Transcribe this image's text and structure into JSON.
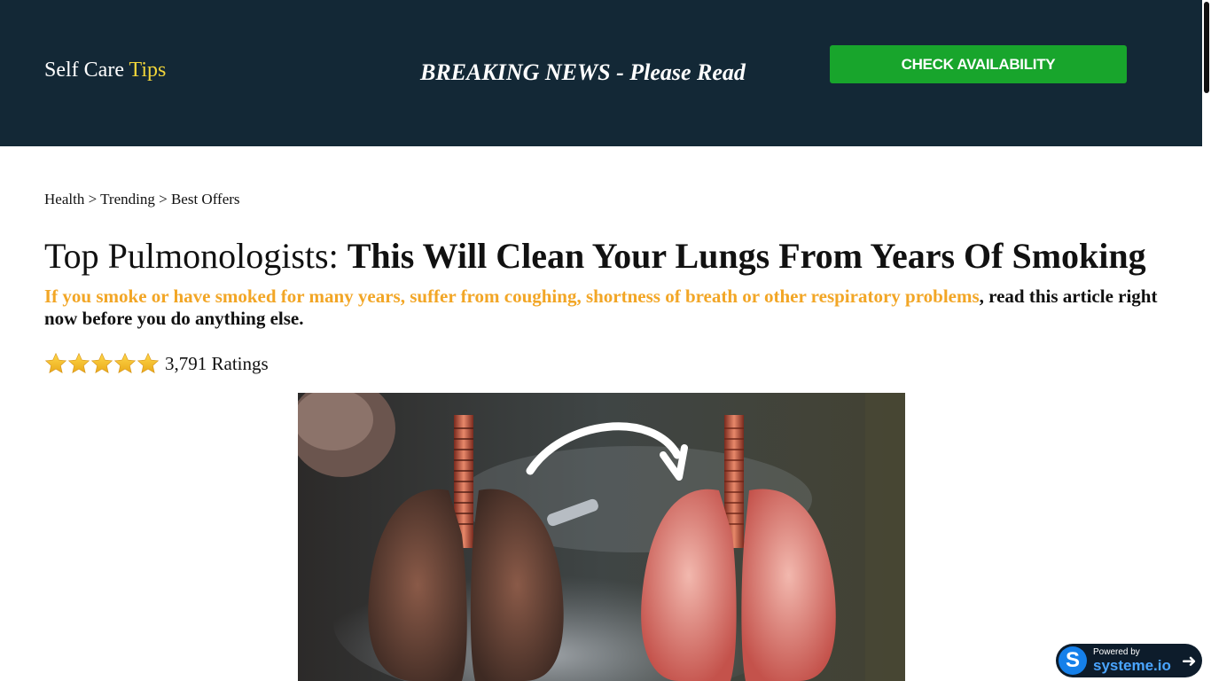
{
  "header": {
    "brand_main": "Self Care",
    "brand_accent": "Tips",
    "breaking": "BREAKING NEWS - Please Read",
    "cta_label": "CHECK AVAILABILITY"
  },
  "breadcrumb": {
    "items": [
      "Health",
      "Trending",
      "Best Offers"
    ],
    "separator": ">"
  },
  "article": {
    "title_prefix": "Top Pulmonologists:",
    "title_bold": "This Will Clean Your Lungs From Years Of Smoking",
    "lead_highlight": "If you smoke or have smoked for many years, suffer from coughing, shortness of breath or other respiratory problems",
    "lead_rest": ", read this article right now before you do anything else.",
    "rating_stars": 5,
    "rating_text": "3,791 Ratings"
  },
  "badge": {
    "logo_letter": "S",
    "powered_by": "Powered by",
    "brand": "systeme.io",
    "arrow": "➜"
  },
  "colors": {
    "header_bg": "#132836",
    "brand_accent": "#f1d53a",
    "cta_bg": "#18a52c",
    "lead_highlight": "#f2a626",
    "star": "#f5c32c"
  },
  "icons": {
    "star": "star-icon",
    "arrow": "arrow-right-icon"
  }
}
